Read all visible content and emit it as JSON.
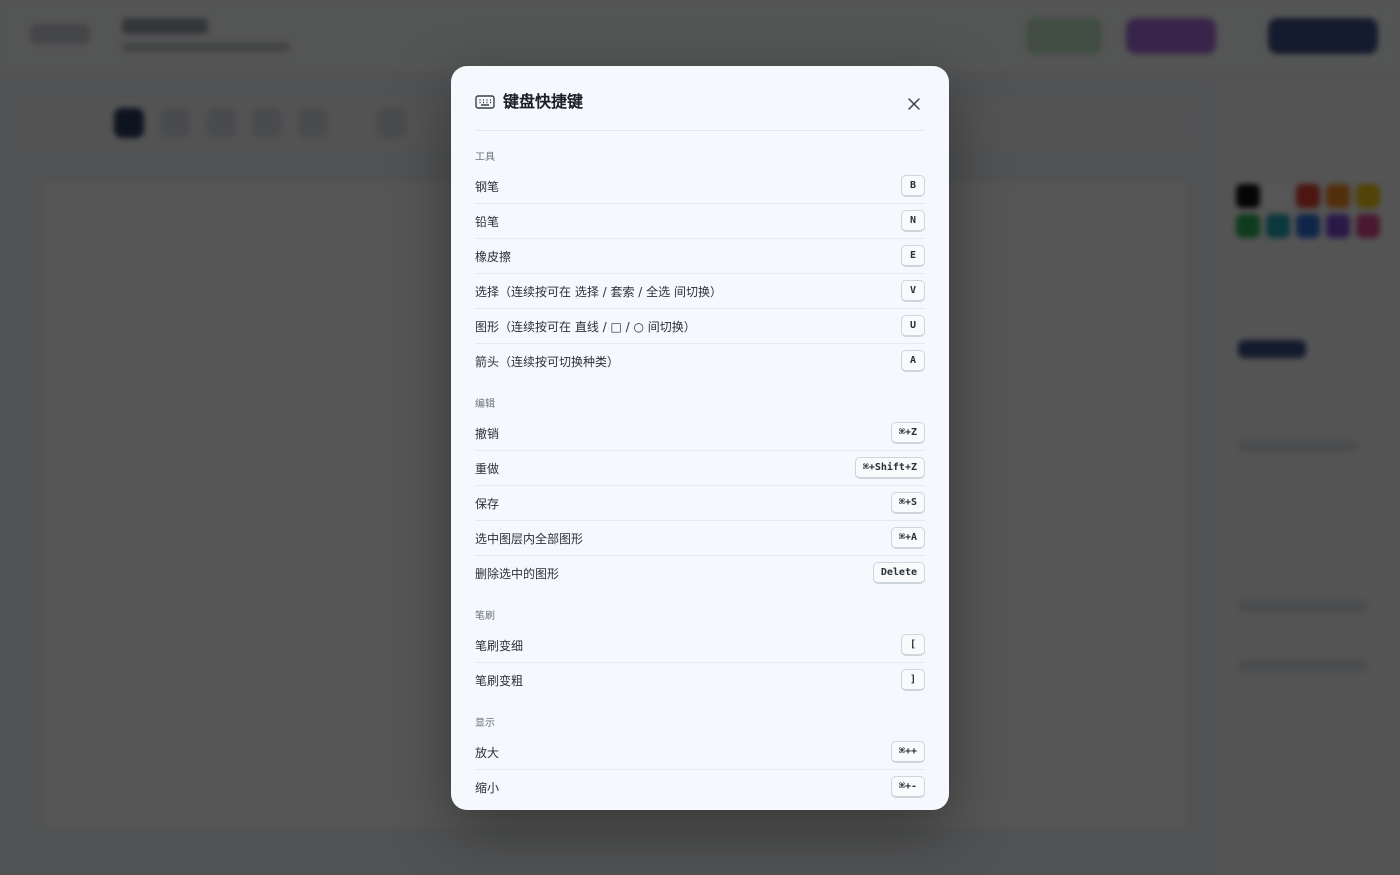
{
  "modal": {
    "title": "键盘快捷键",
    "sections": [
      {
        "title": "工具",
        "items": [
          {
            "label": "钢笔",
            "key": "B"
          },
          {
            "label": "铅笔",
            "key": "N"
          },
          {
            "label": "橡皮擦",
            "key": "E"
          },
          {
            "label": "选择（连续按可在 选择 / 套索 / 全选 间切换）",
            "key": "V"
          },
          {
            "label": "图形（连续按可在 直线 / □ / ○ 间切换）",
            "key": "U"
          },
          {
            "label": "箭头（连续按可切换种类）",
            "key": "A"
          }
        ]
      },
      {
        "title": "编辑",
        "items": [
          {
            "label": "撤销",
            "key": "⌘+Z"
          },
          {
            "label": "重做",
            "key": "⌘+Shift+Z"
          },
          {
            "label": "保存",
            "key": "⌘+S"
          },
          {
            "label": "选中图层内全部图形",
            "key": "⌘+A"
          },
          {
            "label": "删除选中的图形",
            "key": "Delete"
          }
        ]
      },
      {
        "title": "笔刷",
        "items": [
          {
            "label": "笔刷变细",
            "key": "["
          },
          {
            "label": "笔刷变粗",
            "key": "]"
          }
        ]
      },
      {
        "title": "显示",
        "items": [
          {
            "label": "放大",
            "key": "⌘++"
          },
          {
            "label": "缩小",
            "key": "⌘+-"
          }
        ]
      }
    ]
  }
}
